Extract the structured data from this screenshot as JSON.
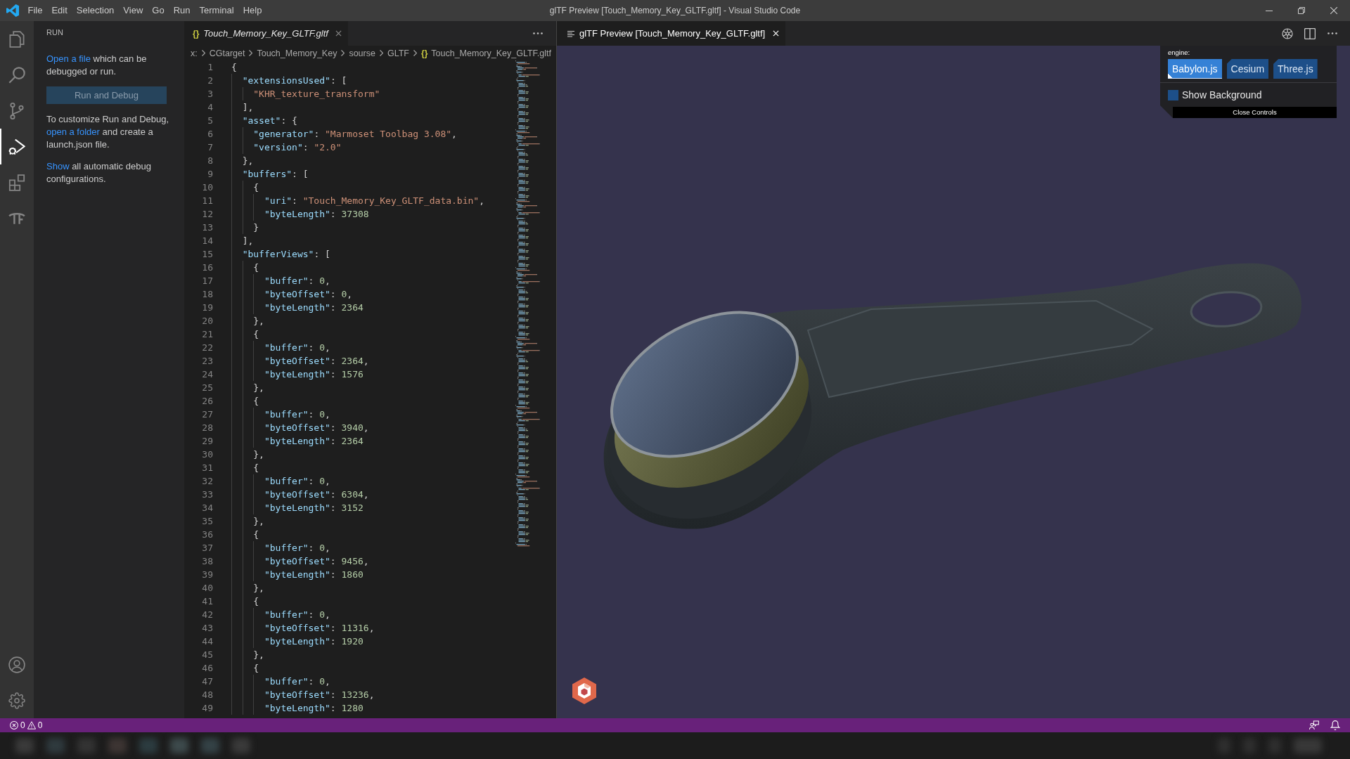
{
  "window": {
    "title": "glTF Preview [Touch_Memory_Key_GLTF.gltf] - Visual Studio Code"
  },
  "menu": [
    "File",
    "Edit",
    "Selection",
    "View",
    "Go",
    "Run",
    "Terminal",
    "Help"
  ],
  "activity_bar": {
    "items": [
      {
        "selected": false
      },
      {
        "selected": false
      },
      {
        "selected": false
      },
      {
        "selected": true
      },
      {
        "selected": false
      },
      {
        "selected": false
      }
    ]
  },
  "sidebar": {
    "title": "RUN",
    "blocks": [
      {
        "kind": "text",
        "parts": [
          {
            "kind": "link",
            "text": "Open a file"
          },
          {
            "kind": "plain",
            "text": " which can be debugged or run."
          }
        ]
      },
      {
        "kind": "button",
        "label": "Run and Debug"
      },
      {
        "kind": "text",
        "parts": [
          {
            "kind": "plain",
            "text": "To customize Run and Debug, "
          },
          {
            "kind": "link",
            "text": "open a folder"
          },
          {
            "kind": "plain",
            "text": " and create a launch.json file."
          }
        ]
      },
      {
        "kind": "text",
        "parts": [
          {
            "kind": "link",
            "text": "Show"
          },
          {
            "kind": "plain",
            "text": " all automatic debug configurations."
          }
        ]
      }
    ]
  },
  "editor": {
    "tab": {
      "icon": "{}",
      "label": "Touch_Memory_Key_GLTF.gltf",
      "preview": true,
      "selected": true
    },
    "breadcrumbs": [
      {
        "text": "x:"
      },
      {
        "text": "CGtarget"
      },
      {
        "text": "Touch_Memory_Key"
      },
      {
        "text": "sourse"
      },
      {
        "text": "GLTF"
      },
      {
        "text": "Touch_Memory_Key_GLTF.gltf",
        "icon": "{}"
      }
    ],
    "lines": [
      {
        "number": "1",
        "tokens": [
          {
            "kind": "open",
            "text": "{"
          }
        ]
      },
      {
        "number": "2",
        "tokens": [
          {
            "kind": "key",
            "text": "\"extensionsUsed\""
          },
          {
            "kind": "punct",
            "text": ": "
          },
          {
            "kind": "open",
            "text": "["
          }
        ]
      },
      {
        "number": "3",
        "tokens": [
          {
            "kind": "string",
            "text": "\"KHR_texture_transform\""
          }
        ]
      },
      {
        "number": "4",
        "tokens": [
          {
            "kind": "close",
            "text": "]"
          },
          {
            "kind": "punct",
            "text": ","
          }
        ]
      },
      {
        "number": "5",
        "tokens": [
          {
            "kind": "key",
            "text": "\"asset\""
          },
          {
            "kind": "punct",
            "text": ": "
          },
          {
            "kind": "open",
            "text": "{"
          }
        ]
      },
      {
        "number": "6",
        "tokens": [
          {
            "kind": "key",
            "text": "\"generator\""
          },
          {
            "kind": "punct",
            "text": ": "
          },
          {
            "kind": "string",
            "text": "\"Marmoset Toolbag 3.08\""
          },
          {
            "kind": "punct",
            "text": ","
          }
        ]
      },
      {
        "number": "7",
        "tokens": [
          {
            "kind": "key",
            "text": "\"version\""
          },
          {
            "kind": "punct",
            "text": ": "
          },
          {
            "kind": "string",
            "text": "\"2.0\""
          }
        ]
      },
      {
        "number": "8",
        "tokens": [
          {
            "kind": "close",
            "text": "}"
          },
          {
            "kind": "punct",
            "text": ","
          }
        ]
      },
      {
        "number": "9",
        "tokens": [
          {
            "kind": "key",
            "text": "\"buffers\""
          },
          {
            "kind": "punct",
            "text": ": "
          },
          {
            "kind": "open",
            "text": "["
          }
        ]
      },
      {
        "number": "10",
        "tokens": [
          {
            "kind": "open",
            "text": "{"
          }
        ]
      },
      {
        "number": "11",
        "tokens": [
          {
            "kind": "key",
            "text": "\"uri\""
          },
          {
            "kind": "punct",
            "text": ": "
          },
          {
            "kind": "string",
            "text": "\"Touch_Memory_Key_GLTF_data.bin\""
          },
          {
            "kind": "punct",
            "text": ","
          }
        ]
      },
      {
        "number": "12",
        "tokens": [
          {
            "kind": "key",
            "text": "\"byteLength\""
          },
          {
            "kind": "punct",
            "text": ": "
          },
          {
            "kind": "number",
            "text": "37308"
          }
        ]
      },
      {
        "number": "13",
        "tokens": [
          {
            "kind": "close",
            "text": "}"
          }
        ]
      },
      {
        "number": "14",
        "tokens": [
          {
            "kind": "close",
            "text": "]"
          },
          {
            "kind": "punct",
            "text": ","
          }
        ]
      },
      {
        "number": "15",
        "tokens": [
          {
            "kind": "key",
            "text": "\"bufferViews\""
          },
          {
            "kind": "punct",
            "text": ": "
          },
          {
            "kind": "open",
            "text": "["
          }
        ]
      },
      {
        "number": "16",
        "tokens": [
          {
            "kind": "open",
            "text": "{"
          }
        ]
      },
      {
        "number": "17",
        "tokens": [
          {
            "kind": "key",
            "text": "\"buffer\""
          },
          {
            "kind": "punct",
            "text": ": "
          },
          {
            "kind": "number",
            "text": "0"
          },
          {
            "kind": "punct",
            "text": ","
          }
        ]
      },
      {
        "number": "18",
        "tokens": [
          {
            "kind": "key",
            "text": "\"byteOffset\""
          },
          {
            "kind": "punct",
            "text": ": "
          },
          {
            "kind": "number",
            "text": "0"
          },
          {
            "kind": "punct",
            "text": ","
          }
        ]
      },
      {
        "number": "19",
        "tokens": [
          {
            "kind": "key",
            "text": "\"byteLength\""
          },
          {
            "kind": "punct",
            "text": ": "
          },
          {
            "kind": "number",
            "text": "2364"
          }
        ]
      },
      {
        "number": "20",
        "tokens": [
          {
            "kind": "close",
            "text": "}"
          },
          {
            "kind": "punct",
            "text": ","
          }
        ]
      },
      {
        "number": "21",
        "tokens": [
          {
            "kind": "open",
            "text": "{"
          }
        ]
      },
      {
        "number": "22",
        "tokens": [
          {
            "kind": "key",
            "text": "\"buffer\""
          },
          {
            "kind": "punct",
            "text": ": "
          },
          {
            "kind": "number",
            "text": "0"
          },
          {
            "kind": "punct",
            "text": ","
          }
        ]
      },
      {
        "number": "23",
        "tokens": [
          {
            "kind": "key",
            "text": "\"byteOffset\""
          },
          {
            "kind": "punct",
            "text": ": "
          },
          {
            "kind": "number",
            "text": "2364"
          },
          {
            "kind": "punct",
            "text": ","
          }
        ]
      },
      {
        "number": "24",
        "tokens": [
          {
            "kind": "key",
            "text": "\"byteLength\""
          },
          {
            "kind": "punct",
            "text": ": "
          },
          {
            "kind": "number",
            "text": "1576"
          }
        ]
      },
      {
        "number": "25",
        "tokens": [
          {
            "kind": "close",
            "text": "}"
          },
          {
            "kind": "punct",
            "text": ","
          }
        ]
      },
      {
        "number": "26",
        "tokens": [
          {
            "kind": "open",
            "text": "{"
          }
        ]
      },
      {
        "number": "27",
        "tokens": [
          {
            "kind": "key",
            "text": "\"buffer\""
          },
          {
            "kind": "punct",
            "text": ": "
          },
          {
            "kind": "number",
            "text": "0"
          },
          {
            "kind": "punct",
            "text": ","
          }
        ]
      },
      {
        "number": "28",
        "tokens": [
          {
            "kind": "key",
            "text": "\"byteOffset\""
          },
          {
            "kind": "punct",
            "text": ": "
          },
          {
            "kind": "number",
            "text": "3940"
          },
          {
            "kind": "punct",
            "text": ","
          }
        ]
      },
      {
        "number": "29",
        "tokens": [
          {
            "kind": "key",
            "text": "\"byteLength\""
          },
          {
            "kind": "punct",
            "text": ": "
          },
          {
            "kind": "number",
            "text": "2364"
          }
        ]
      },
      {
        "number": "30",
        "tokens": [
          {
            "kind": "close",
            "text": "}"
          },
          {
            "kind": "punct",
            "text": ","
          }
        ]
      },
      {
        "number": "31",
        "tokens": [
          {
            "kind": "open",
            "text": "{"
          }
        ]
      },
      {
        "number": "32",
        "tokens": [
          {
            "kind": "key",
            "text": "\"buffer\""
          },
          {
            "kind": "punct",
            "text": ": "
          },
          {
            "kind": "number",
            "text": "0"
          },
          {
            "kind": "punct",
            "text": ","
          }
        ]
      },
      {
        "number": "33",
        "tokens": [
          {
            "kind": "key",
            "text": "\"byteOffset\""
          },
          {
            "kind": "punct",
            "text": ": "
          },
          {
            "kind": "number",
            "text": "6304"
          },
          {
            "kind": "punct",
            "text": ","
          }
        ]
      },
      {
        "number": "34",
        "tokens": [
          {
            "kind": "key",
            "text": "\"byteLength\""
          },
          {
            "kind": "punct",
            "text": ": "
          },
          {
            "kind": "number",
            "text": "3152"
          }
        ]
      },
      {
        "number": "35",
        "tokens": [
          {
            "kind": "close",
            "text": "}"
          },
          {
            "kind": "punct",
            "text": ","
          }
        ]
      },
      {
        "number": "36",
        "tokens": [
          {
            "kind": "open",
            "text": "{"
          }
        ]
      },
      {
        "number": "37",
        "tokens": [
          {
            "kind": "key",
            "text": "\"buffer\""
          },
          {
            "kind": "punct",
            "text": ": "
          },
          {
            "kind": "number",
            "text": "0"
          },
          {
            "kind": "punct",
            "text": ","
          }
        ]
      },
      {
        "number": "38",
        "tokens": [
          {
            "kind": "key",
            "text": "\"byteOffset\""
          },
          {
            "kind": "punct",
            "text": ": "
          },
          {
            "kind": "number",
            "text": "9456"
          },
          {
            "kind": "punct",
            "text": ","
          }
        ]
      },
      {
        "number": "39",
        "tokens": [
          {
            "kind": "key",
            "text": "\"byteLength\""
          },
          {
            "kind": "punct",
            "text": ": "
          },
          {
            "kind": "number",
            "text": "1860"
          }
        ]
      },
      {
        "number": "40",
        "tokens": [
          {
            "kind": "close",
            "text": "}"
          },
          {
            "kind": "punct",
            "text": ","
          }
        ]
      },
      {
        "number": "41",
        "tokens": [
          {
            "kind": "open",
            "text": "{"
          }
        ]
      },
      {
        "number": "42",
        "tokens": [
          {
            "kind": "key",
            "text": "\"buffer\""
          },
          {
            "kind": "punct",
            "text": ": "
          },
          {
            "kind": "number",
            "text": "0"
          },
          {
            "kind": "punct",
            "text": ","
          }
        ]
      },
      {
        "number": "43",
        "tokens": [
          {
            "kind": "key",
            "text": "\"byteOffset\""
          },
          {
            "kind": "punct",
            "text": ": "
          },
          {
            "kind": "number",
            "text": "11316"
          },
          {
            "kind": "punct",
            "text": ","
          }
        ]
      },
      {
        "number": "44",
        "tokens": [
          {
            "kind": "key",
            "text": "\"byteLength\""
          },
          {
            "kind": "punct",
            "text": ": "
          },
          {
            "kind": "number",
            "text": "1920"
          }
        ]
      },
      {
        "number": "45",
        "tokens": [
          {
            "kind": "close",
            "text": "}"
          },
          {
            "kind": "punct",
            "text": ","
          }
        ]
      },
      {
        "number": "46",
        "tokens": [
          {
            "kind": "open",
            "text": "{"
          }
        ]
      },
      {
        "number": "47",
        "tokens": [
          {
            "kind": "key",
            "text": "\"buffer\""
          },
          {
            "kind": "punct",
            "text": ": "
          },
          {
            "kind": "number",
            "text": "0"
          },
          {
            "kind": "punct",
            "text": ","
          }
        ]
      },
      {
        "number": "48",
        "tokens": [
          {
            "kind": "key",
            "text": "\"byteOffset\""
          },
          {
            "kind": "punct",
            "text": ": "
          },
          {
            "kind": "number",
            "text": "13236"
          },
          {
            "kind": "punct",
            "text": ","
          }
        ]
      },
      {
        "number": "49",
        "tokens": [
          {
            "kind": "key",
            "text": "\"byteLength\""
          },
          {
            "kind": "punct",
            "text": ": "
          },
          {
            "kind": "number",
            "text": "1280"
          }
        ]
      }
    ]
  },
  "preview": {
    "tab": {
      "label": "glTF Preview [Touch_Memory_Key_GLTF.gltf]",
      "selected": true
    },
    "controls": {
      "label": "engine:",
      "engines": [
        {
          "label": "Babylon.js",
          "selected": true
        },
        {
          "label": "Cesium",
          "selected": false
        },
        {
          "label": "Three.js",
          "selected": false
        }
      ],
      "show_background": {
        "label": "Show Background",
        "checked": false
      },
      "close": "Close Controls"
    }
  },
  "status_bar": {
    "errors": "0",
    "warnings": "0"
  }
}
